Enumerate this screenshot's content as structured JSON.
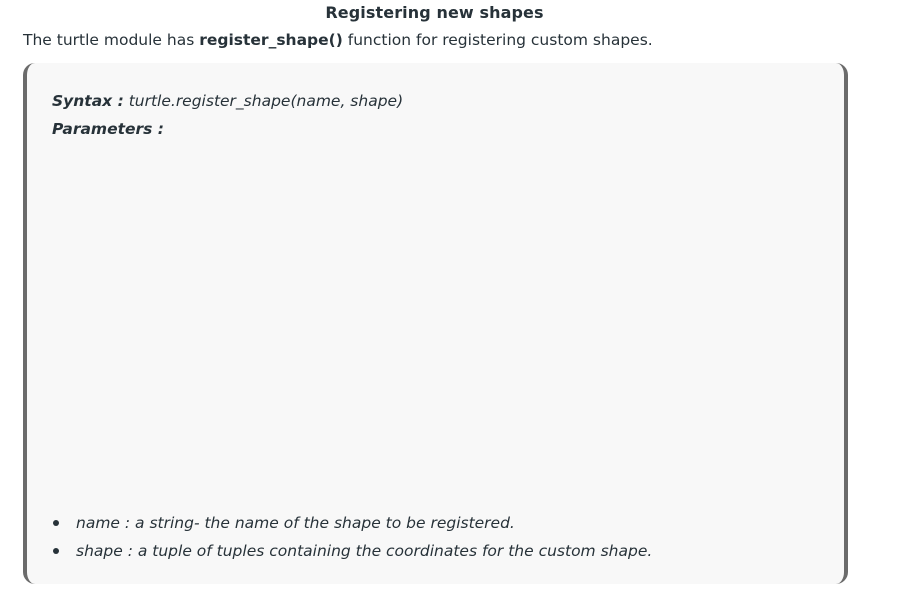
{
  "heading": "Registering new shapes",
  "intro": {
    "prefix": "The turtle module has ",
    "func": "register_shape()",
    "suffix": " function for registering custom shapes."
  },
  "syntax": {
    "label": "Syntax :",
    "value": " turtle.register_shape(name, shape)"
  },
  "parameters_label": "Parameters :",
  "parameters": [
    "name : a string- the name of the shape to be registered.",
    "shape : a tuple of tuples containing the coordinates for the custom shape."
  ]
}
